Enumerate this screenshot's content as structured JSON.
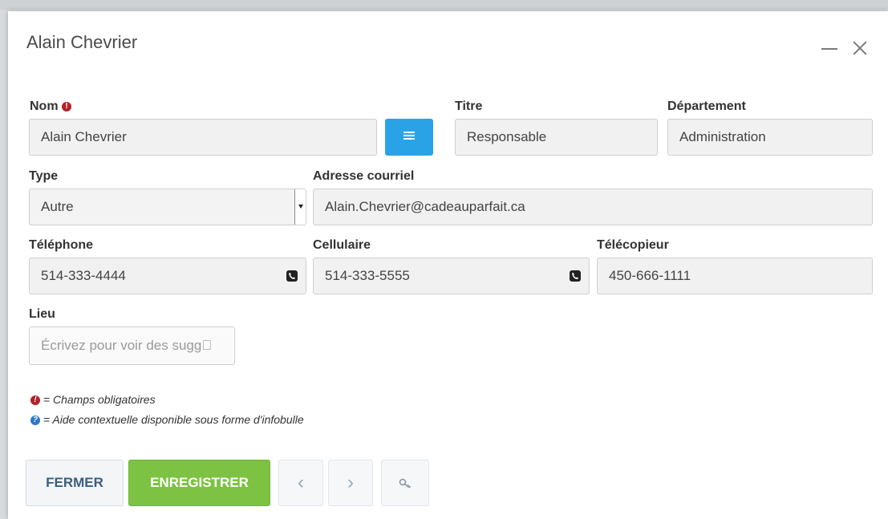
{
  "dialog": {
    "title": "Alain Chevrier"
  },
  "fields": {
    "nom": {
      "label": "Nom",
      "value": "Alain Chevrier"
    },
    "titre": {
      "label": "Titre",
      "value": "Responsable"
    },
    "departement": {
      "label": "Département",
      "value": "Administration"
    },
    "type": {
      "label": "Type",
      "value": "Autre"
    },
    "courriel": {
      "label": "Adresse courriel",
      "value": "Alain.Chevrier@cadeauparfait.ca"
    },
    "telephone": {
      "label": "Téléphone",
      "value": "514-333-4444"
    },
    "cellulaire": {
      "label": "Cellulaire",
      "value": "514-333-5555"
    },
    "telecopieur": {
      "label": "Télécopieur",
      "value": "450-666-1111"
    },
    "lieu": {
      "label": "Lieu",
      "placeholder": "Écrivez pour voir des sugg\u0000"
    }
  },
  "legend": {
    "required": "= Champs obligatoires",
    "help": "= Aide contextuelle disponible sous forme d'infobulle"
  },
  "buttons": {
    "close": "FERMER",
    "save": "ENREGISTRER",
    "prev": "‹",
    "next": "›"
  },
  "icons": {
    "required": "exclamation-circle-icon",
    "help": "question-circle-icon",
    "phone": "phone-square-icon",
    "list": "list-icon",
    "key": "key-icon"
  },
  "colors": {
    "required": "#b0232a",
    "help": "#2f78c4",
    "list_button": "#2aa3e6",
    "save_button": "#7dc243",
    "close_button_text": "#3a5f7f"
  }
}
